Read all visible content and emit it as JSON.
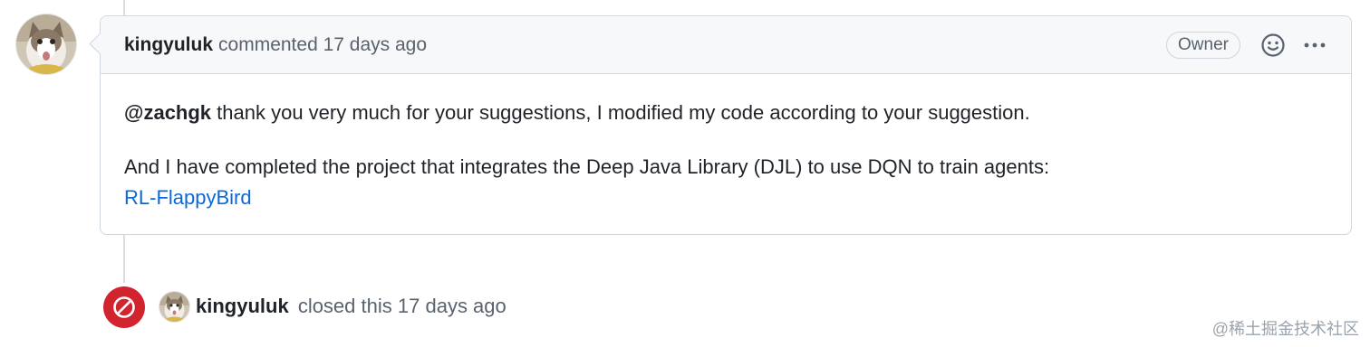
{
  "comment": {
    "author": "kingyuluk",
    "action": "commented",
    "time": "17 days ago",
    "role_badge": "Owner",
    "reaction_icon": "smiley-icon",
    "menu_icon": "kebab-horizontal-icon",
    "body": {
      "mention": "@zachgk",
      "paragraph1_text": " thank you very much for your suggestions, I modified my code according to your suggestion.",
      "paragraph2_text": "And I have completed the project that integrates the Deep Java Library (DJL) to use DQN to train agents:",
      "link_text": "RL-FlappyBird"
    }
  },
  "event": {
    "icon": "circle-slash-icon",
    "author": "kingyuluk",
    "action": "closed this",
    "time": "17 days ago",
    "badge_color": "#d1242f"
  },
  "watermark": "@稀土掘金技术社区",
  "colors": {
    "link": "#0969da",
    "border": "#d0d7de",
    "header_bg": "#f6f8fa",
    "muted_text": "#59636e"
  }
}
